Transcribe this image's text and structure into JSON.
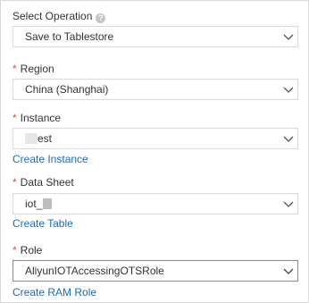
{
  "operation": {
    "label": "Select Operation",
    "help_icon": "question-circle-icon",
    "value": "Save to Tablestore"
  },
  "region": {
    "required_mark": "*",
    "label": "Region",
    "value": "China (Shanghai)"
  },
  "instance": {
    "required_mark": "*",
    "label": "Instance",
    "value_suffix": "est",
    "create_link": "Create Instance"
  },
  "data_sheet": {
    "required_mark": "*",
    "label": "Data Sheet",
    "value_prefix": "iot_",
    "create_link": "Create Table"
  },
  "role": {
    "required_mark": "*",
    "label": "Role",
    "value": "AliyunIOTAccessingOTSRole",
    "create_link": "Create RAM Role"
  },
  "colors": {
    "required": "#e84738",
    "link": "#1b6ac3",
    "border": "#d9d9d9",
    "active_border": "#8a8a8a"
  },
  "icons": {
    "dropdown": "chevron-down-icon"
  }
}
